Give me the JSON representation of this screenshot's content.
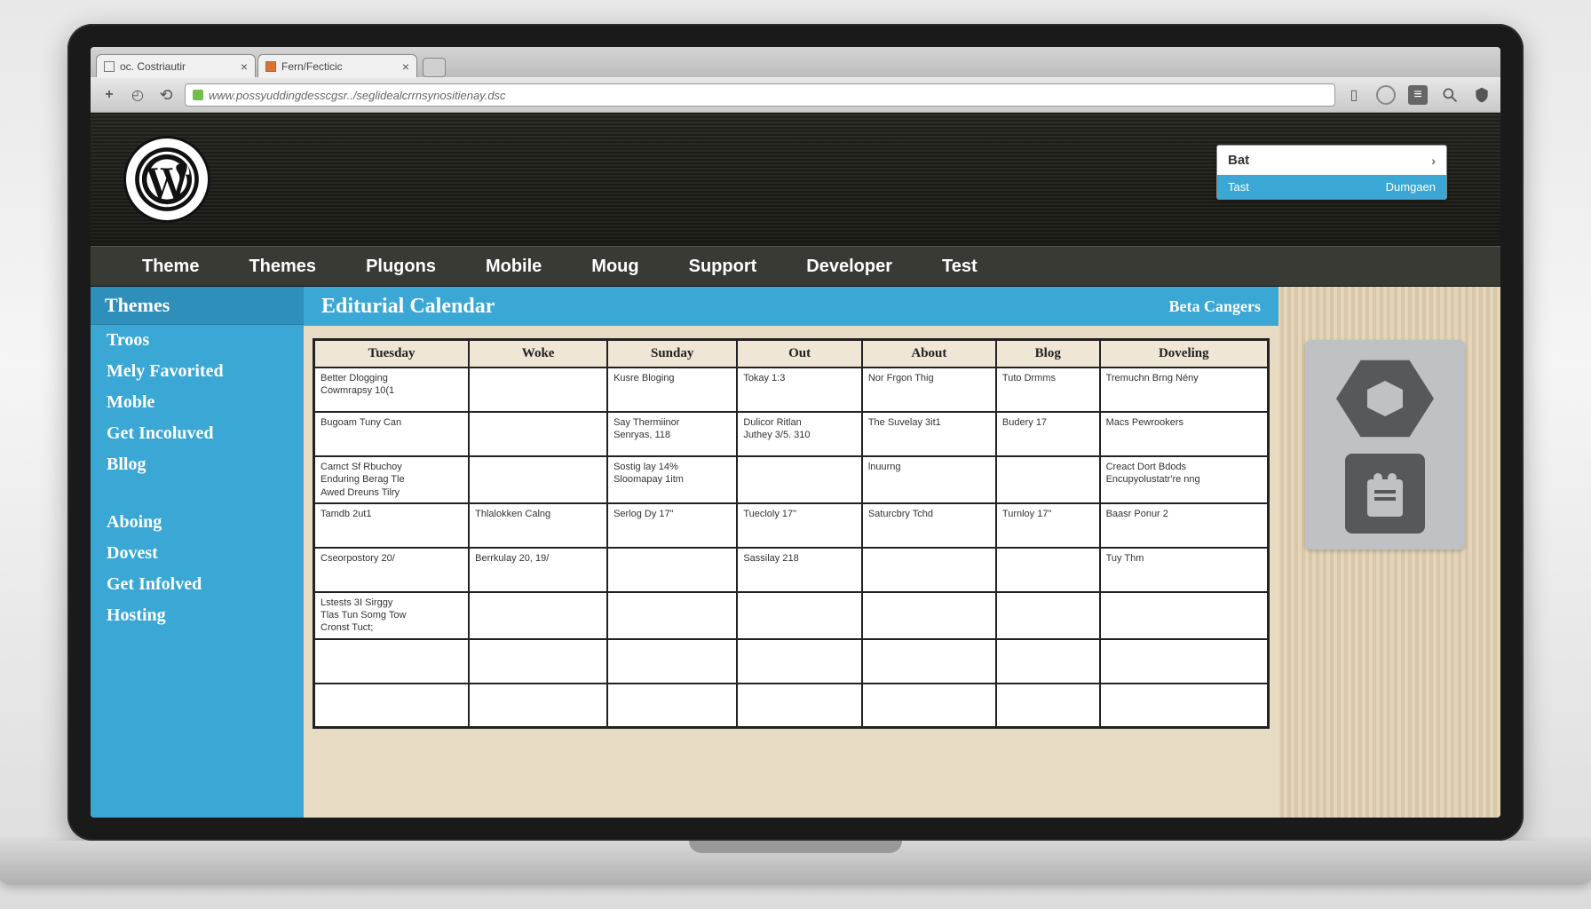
{
  "browser": {
    "tabs": [
      {
        "label": "oc. Costriautir"
      },
      {
        "label": "Fern/Fecticic"
      }
    ],
    "url": "www.possyuddingdesscgsr../seglidealcrrnsynositienay.dsc"
  },
  "header": {
    "userbox": {
      "line1": "Bat",
      "line2_left": "Tast",
      "line2_right": "Dumgaen"
    }
  },
  "nav": [
    "Theme",
    "Themes",
    "Plugons",
    "Mobile",
    "Moug",
    "Support",
    "Developer",
    "Test"
  ],
  "sidebar": {
    "header": "Themes",
    "group1": [
      "Troos",
      "Mely Favorited",
      "Moble",
      "Get Incoluved",
      "Bllog"
    ],
    "group2": [
      "Aboing",
      "Dovest",
      "Get Infolved",
      "Hosting"
    ]
  },
  "titlebar": {
    "main": "Editurial Calendar",
    "sub": "Beta Cangers"
  },
  "calendar": {
    "headers": [
      "Tuesday",
      "Woke",
      "Sunday",
      "Out",
      "About",
      "Blog",
      "Doveling"
    ],
    "rows": [
      [
        "Better Dlogging\nCowmrapsy 10(1",
        "",
        "Kusre Bloging",
        "Tokay 1:3",
        "Nor Frgon Thig",
        "Tuto Drmms",
        "Tremuchn Brng Nény"
      ],
      [
        "Bugoam Tuny Can",
        "",
        "Say Thermiinor\nSenryas, 118",
        "Dulicor Ritlan\nJuthey 3/5. 310",
        "The Suvelay 3it1",
        "Budery 17",
        "Macs Pewrookers"
      ],
      [
        "Camct Sf Rbuchoy\nEnduring Berag Tle\nAwed Dreuns Tilry",
        "",
        "Sostig lay 14%\nSloomapay 1itm",
        "",
        "lnuurng",
        "",
        "Creact Dort Bdods\nEncupyolustatr're nng"
      ],
      [
        "Tamdb 2ut1",
        "Thlalokken Calng",
        "Serlog Dy 17\"",
        "Tuecloly 17\"",
        "Saturcbry Tchd",
        "Turnloy 17\"",
        "Baasr Ponur 2"
      ],
      [
        "Cseorpostory 20/",
        "Berrkulay 20, 19/",
        "",
        "Sassilay 218",
        "",
        "",
        "Tuy Thm"
      ],
      [
        "Lstests 3I Sirggy\nTlas Tun Somg Tow\nCronst Tuct;",
        "",
        "",
        "",
        "",
        "",
        ""
      ],
      [
        "",
        "",
        "",
        "",
        "",
        "",
        ""
      ],
      [
        "",
        "",
        "",
        "",
        "",
        "",
        ""
      ]
    ]
  }
}
